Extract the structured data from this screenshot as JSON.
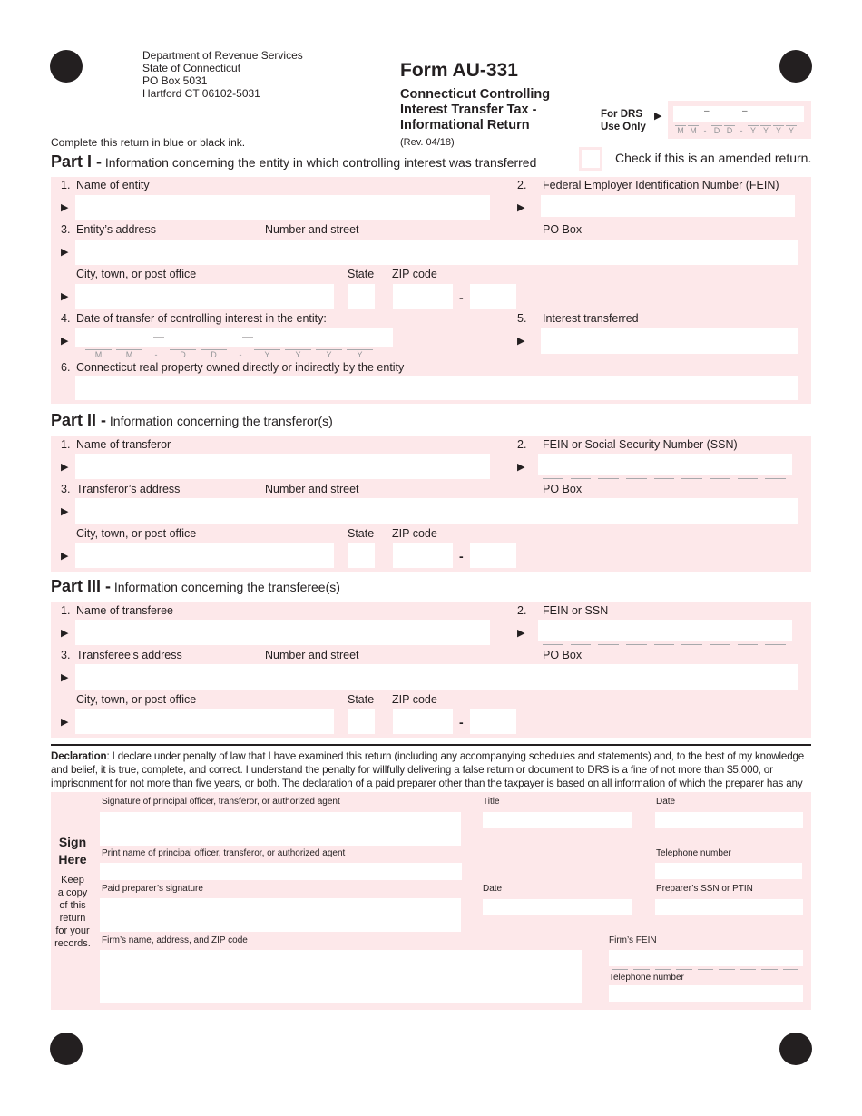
{
  "agency": {
    "lines": [
      "Department of Revenue Services",
      "State of Connecticut",
      "PO Box 5031",
      "Hartford CT 06102-5031"
    ]
  },
  "form": {
    "title": "Form AU-331",
    "subtitle_lines": [
      "Connecticut Controlling",
      "Interest Transfer Tax -",
      "Informational Return"
    ],
    "revision": "(Rev. 04/18)",
    "ink_note": "Complete this return in blue or black ink."
  },
  "drs_use": {
    "label_lines": [
      "For DRS",
      "Use Only"
    ],
    "date_seps": [
      "–",
      "–"
    ],
    "date_mask": [
      "M",
      "M",
      "-",
      "D",
      "D",
      "-",
      "Y",
      "Y",
      "Y",
      "Y"
    ]
  },
  "amended": {
    "label": "Check if this is an amended return.",
    "checked": false
  },
  "part1": {
    "title": "Part I -",
    "description": "Information concerning the entity in which controlling interest was transferred",
    "fields": {
      "name_num": "1.",
      "name_label": "Name of entity",
      "fein_num": "2.",
      "fein_label": "Federal Employer Identification Number (FEIN)",
      "address_num": "3.",
      "address_label": "Entity’s address",
      "street_label": "Number and street",
      "pobox_label": "PO Box",
      "city_label": "City, town, or post office",
      "state_label": "State",
      "zip_label": "ZIP code",
      "zip_sep": "-",
      "date_num": "4.",
      "date_label": "Date of transfer of controlling interest in the entity:",
      "date_seps": [
        "—",
        "—"
      ],
      "date_mask": [
        "M",
        "M",
        "-",
        "D",
        "D",
        "-",
        "Y",
        "Y",
        "Y",
        "Y"
      ],
      "interest_num": "5.",
      "interest_label": "Interest transferred",
      "property_num": "6.",
      "property_label": "Connecticut real property owned directly or indirectly by the entity"
    }
  },
  "part2": {
    "title": "Part II -",
    "description": "Information concerning the transferor(s)",
    "fields": {
      "name_num": "1.",
      "name_label": "Name of transferor",
      "id_num": "2.",
      "id_label": "FEIN or Social Security Number (SSN)",
      "address_num": "3.",
      "address_label": "Transferor’s address",
      "street_label": "Number and street",
      "pobox_label": "PO Box",
      "city_label": "City, town, or post office",
      "state_label": "State",
      "zip_label": "ZIP code",
      "zip_sep": "-"
    }
  },
  "part3": {
    "title": "Part III -",
    "description": "Information concerning the transferee(s)",
    "fields": {
      "name_num": "1.",
      "name_label": "Name of transferee",
      "id_num": "2.",
      "id_label": "FEIN or SSN",
      "address_num": "3.",
      "address_label": "Transferee’s address",
      "street_label": "Number and street",
      "pobox_label": "PO Box",
      "city_label": "City, town, or post office",
      "state_label": "State",
      "zip_label": "ZIP code",
      "zip_sep": "-"
    }
  },
  "declaration": {
    "heading": "Declaration",
    "text": ": I declare under penalty of law that I have examined this return (including any accompanying schedules and statements) and, to the best of my knowledge and belief, it is true, complete, and correct. I understand the penalty for willfully delivering a false return or document to DRS is a fine of not more than $5,000, or imprisonment for not more than five years, or both. The declaration of a paid preparer other than the taxpayer is based on all information of which the preparer has any knowledge."
  },
  "sign": {
    "heading_lines": [
      "Sign",
      "Here"
    ],
    "note_lines": [
      "Keep",
      "a copy",
      "of this",
      "return",
      "for your",
      "records."
    ],
    "signature_label": "Signature of principal officer, transferor, or authorized agent",
    "title_label": "Title",
    "date_label": "Date",
    "print_name_label": "Print name of principal officer, transferor, or authorized agent",
    "telephone_label": "Telephone number",
    "preparer_signature_label": "Paid preparer’s signature",
    "preparer_date_label": "Date",
    "preparer_id_label": "Preparer’s SSN or PTIN",
    "firm_label": "Firm’s name, address, and ZIP code",
    "firm_fein_label": "Firm’s FEIN",
    "firm_telephone_label": "Telephone number"
  },
  "colors": {
    "section_bg": "#fde8ea",
    "text": "#231f20",
    "mask_gray": "#939598"
  },
  "icons": {
    "arrow": "▶",
    "registration_mark": "filled-circle"
  }
}
